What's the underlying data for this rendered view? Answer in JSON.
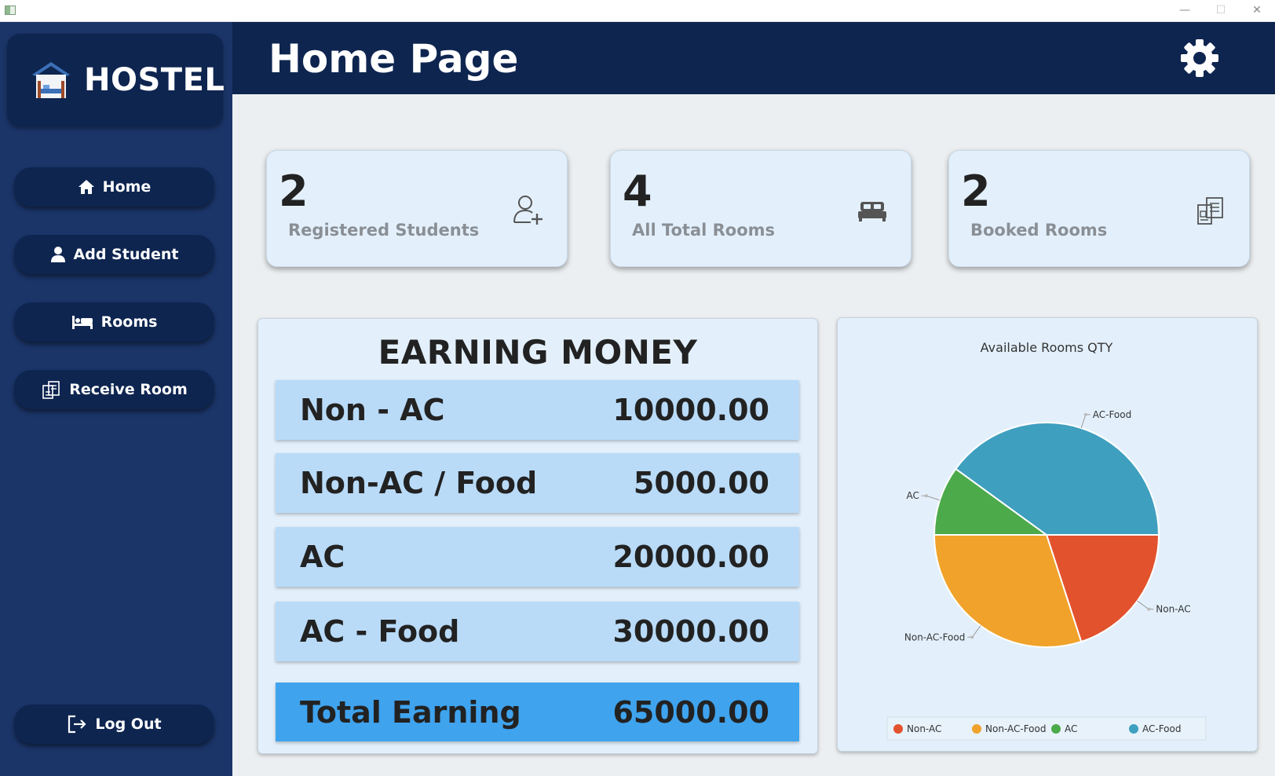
{
  "window": {
    "minimize_glyph": "—",
    "maximize_glyph": "☐",
    "close_glyph": "✕"
  },
  "sidebar": {
    "logo_text": "HOSTEL",
    "logo_icon": "hostel-icon",
    "items": [
      {
        "label": "Home",
        "icon": "home-icon"
      },
      {
        "label": "Add Student",
        "icon": "user-icon"
      },
      {
        "label": "Rooms",
        "icon": "bed-icon"
      },
      {
        "label": "Receive Room",
        "icon": "receive-room-icon"
      }
    ],
    "logout_label": "Log Out",
    "logout_icon": "logout-icon"
  },
  "header": {
    "title": "Home Page",
    "settings_icon": "gear-icon"
  },
  "stats": [
    {
      "value": "2",
      "label": "Registered Students",
      "icon": "add-user-icon"
    },
    {
      "value": "4",
      "label": "All Total Rooms",
      "icon": "bed-icon"
    },
    {
      "value": "2",
      "label": "Booked Rooms",
      "icon": "booked-icon"
    }
  ],
  "earnings": {
    "title": "EARNING MONEY",
    "rows": [
      {
        "label": "Non - AC",
        "value": "10000.00"
      },
      {
        "label": "Non-AC / Food",
        "value": "5000.00"
      },
      {
        "label": "AC",
        "value": "20000.00"
      },
      {
        "label": "AC - Food",
        "value": "30000.00"
      }
    ],
    "total": {
      "label": "Total Earning",
      "value": "65000.00"
    }
  },
  "colors": {
    "sidebar": "#1b3569",
    "header": "#0e2550",
    "card_bg": "#e3f0fc",
    "row_bg": "#b9dbf8",
    "total_bg": "#3fa3ee"
  },
  "chart_data": {
    "type": "pie",
    "title": "Available Rooms QTY",
    "labels": [
      "Non-AC",
      "Non-AC-Food",
      "AC",
      "AC-Food"
    ],
    "values": [
      2,
      3,
      1,
      4
    ],
    "colors": [
      "#e2522d",
      "#f0a22a",
      "#4caa4a",
      "#3f9fbf"
    ],
    "start_angle_deg": 0,
    "direction": "clockwise",
    "legend_position": "bottom"
  }
}
